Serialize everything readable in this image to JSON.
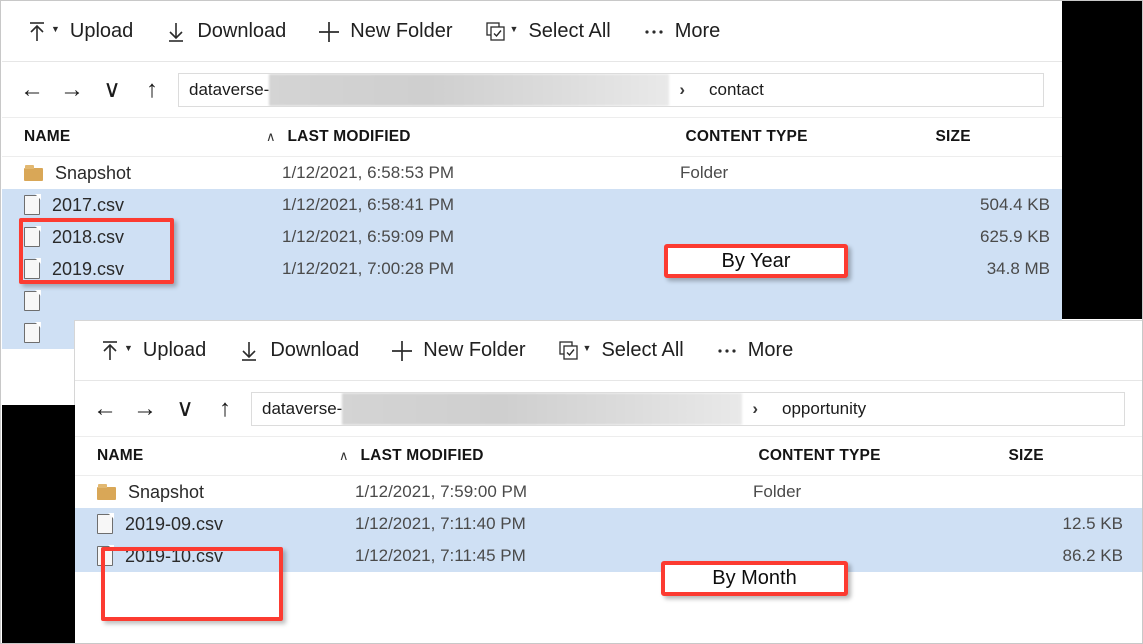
{
  "toolbar": {
    "items": [
      {
        "icon": "upload-icon",
        "label": "Upload",
        "has_caret": true
      },
      {
        "icon": "download-icon",
        "label": "Download",
        "has_caret": false
      },
      {
        "icon": "plus-icon",
        "label": "New Folder",
        "has_caret": false
      },
      {
        "icon": "select-all-icon",
        "label": "Select All",
        "has_caret": true
      },
      {
        "icon": "ellipsis-icon",
        "label": "More",
        "has_caret": false
      }
    ]
  },
  "nav": {
    "back": "←",
    "forward": "→",
    "recent": "∨",
    "up": "↑",
    "separator": "›"
  },
  "columns": {
    "name": "NAME",
    "last_modified": "LAST MODIFIED",
    "content_type": "CONTENT TYPE",
    "size": "SIZE",
    "sort_caret": "∧"
  },
  "panel_contact": {
    "breadcrumb_prefix": "dataverse-",
    "breadcrumb_current": "contact",
    "rows": [
      {
        "icon": "folder-icon",
        "name": "Snapshot",
        "modified": "1/12/2021, 6:58:53 PM",
        "type": "Folder",
        "size": "",
        "selected": false
      },
      {
        "icon": "document-icon",
        "name": "2017.csv",
        "modified": "1/12/2021, 6:58:41 PM",
        "type": "",
        "size": "504.4 KB",
        "selected": true
      },
      {
        "icon": "document-icon",
        "name": "2018.csv",
        "modified": "1/12/2021, 6:59:09 PM",
        "type": "",
        "size": "625.9 KB",
        "selected": true
      },
      {
        "icon": "document-icon",
        "name": "2019.csv",
        "modified": "1/12/2021, 7:00:28 PM",
        "type": "",
        "size": "34.8 MB",
        "selected": true
      },
      {
        "icon": "document-icon",
        "name": "",
        "modified": "",
        "type": "",
        "size": "",
        "selected": true
      },
      {
        "icon": "document-icon",
        "name": "",
        "modified": "",
        "type": "",
        "size": "",
        "selected": true
      }
    ]
  },
  "panel_opportunity": {
    "breadcrumb_prefix": "dataverse-",
    "breadcrumb_current": "opportunity",
    "rows": [
      {
        "icon": "folder-icon",
        "name": "Snapshot",
        "modified": "1/12/2021, 7:59:00 PM",
        "type": "Folder",
        "size": "",
        "selected": false
      },
      {
        "icon": "document-icon",
        "name": "2019-09.csv",
        "modified": "1/12/2021, 7:11:40 PM",
        "type": "",
        "size": "12.5 KB",
        "selected": true
      },
      {
        "icon": "document-icon",
        "name": "2019-10.csv",
        "modified": "1/12/2021, 7:11:45 PM",
        "type": "",
        "size": "86.2 KB",
        "selected": true
      }
    ]
  },
  "callouts": {
    "by_year": "By Year",
    "by_month": "By Month"
  },
  "colors": {
    "selection": "#cfe0f4",
    "callout_border": "#fc3b31",
    "folder": "#d9a757",
    "mask": "#000000"
  }
}
